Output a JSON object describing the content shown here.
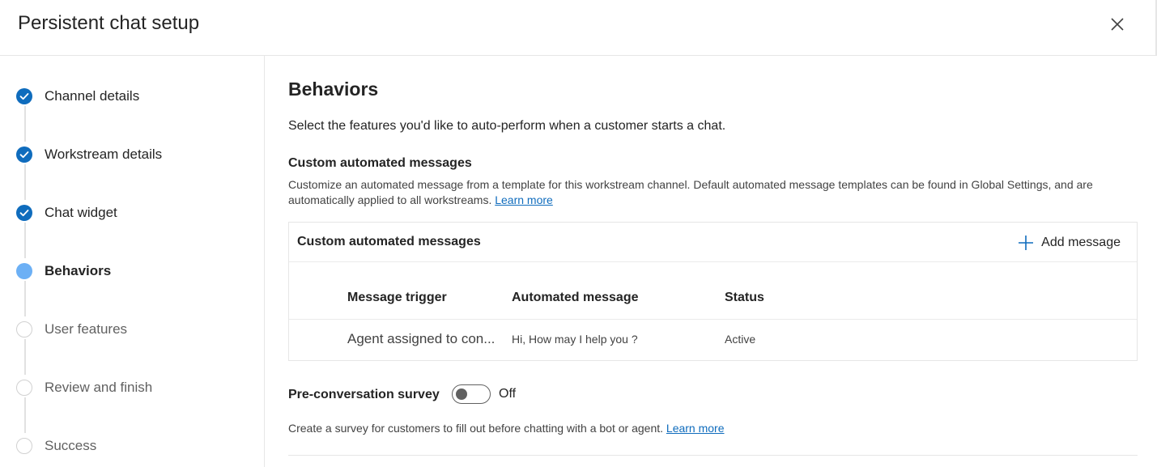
{
  "header": {
    "title": "Persistent chat setup",
    "close_icon": "close-icon"
  },
  "steps": [
    {
      "label": "Channel details",
      "state": "done"
    },
    {
      "label": "Workstream details",
      "state": "done"
    },
    {
      "label": "Chat widget",
      "state": "done"
    },
    {
      "label": "Behaviors",
      "state": "current"
    },
    {
      "label": "User features",
      "state": "todo"
    },
    {
      "label": "Review and finish",
      "state": "todo"
    },
    {
      "label": "Success",
      "state": "todo"
    }
  ],
  "main": {
    "title": "Behaviors",
    "intro": "Select the features you'd like to auto-perform when a customer starts a chat.",
    "automated": {
      "section_title": "Custom automated messages",
      "description": "Customize an automated message from a template for this workstream channel. Default automated message templates can be found in Global Settings, and are automatically applied to all workstreams.",
      "learn_more": "Learn more",
      "card_title": "Custom automated messages",
      "add_label": "Add message",
      "columns": [
        "Message trigger",
        "Automated message",
        "Status"
      ],
      "rows": [
        {
          "trigger": "Agent assigned to con...",
          "message": "Hi, How may I help you ?",
          "status": "Active"
        }
      ]
    },
    "survey": {
      "label": "Pre-conversation survey",
      "toggle_state": "Off",
      "enabled": false,
      "description": "Create a survey for customers to fill out before chatting with a bot or agent.",
      "learn_more": "Learn more"
    }
  },
  "colors": {
    "accent": "#0f6cbd",
    "current_step": "#6cb0f5"
  }
}
